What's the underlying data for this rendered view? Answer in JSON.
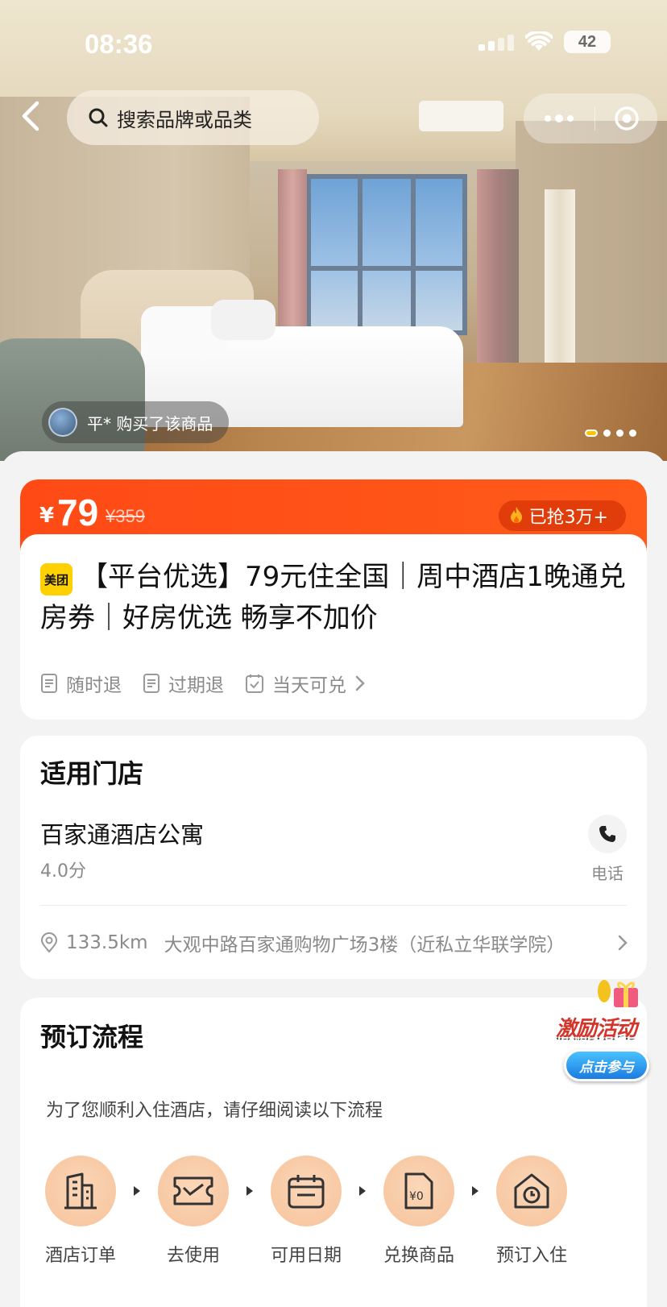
{
  "status_bar": {
    "time": "08:36",
    "battery": "42"
  },
  "nav": {
    "search_placeholder": "搜索品牌或品类"
  },
  "hero": {
    "buyer_notice": "平* 购买了该商品",
    "carousel_count": 4,
    "carousel_active": 0
  },
  "price": {
    "currency": "¥",
    "current": "79",
    "original": "¥359",
    "sold": "已抢3万+",
    "brand_tag": "美团",
    "title": "【平台优选】79元住全国｜周中酒店1晚通兑房券｜好房优选 畅享不加价",
    "features": [
      "随时退",
      "过期退",
      "当天可兑"
    ]
  },
  "store": {
    "heading": "适用门店",
    "name": "百家通酒店公寓",
    "score": "4.0分",
    "phone_label": "电话",
    "distance": "133.5km",
    "address": "大观中路百家通购物广场3楼（近私立华联学院）"
  },
  "booking": {
    "heading": "预订流程",
    "hint": "为了您顺利入住酒店，请仔细阅读以下流程",
    "steps": [
      {
        "label": "酒店订单",
        "icon": "building-icon"
      },
      {
        "label": "去使用",
        "icon": "ticket-icon"
      },
      {
        "label": "可用日期",
        "icon": "calendar-icon"
      },
      {
        "label": "兑换商品",
        "icon": "voucher-icon"
      },
      {
        "label": "预订入住",
        "icon": "house-clock-icon"
      }
    ]
  },
  "promo": {
    "title": "激励活动",
    "button": "点击参与"
  },
  "colors": {
    "accent": "#ff4a16",
    "brand_yellow": "#ffd100",
    "step_circle": "#f7c6a0"
  }
}
